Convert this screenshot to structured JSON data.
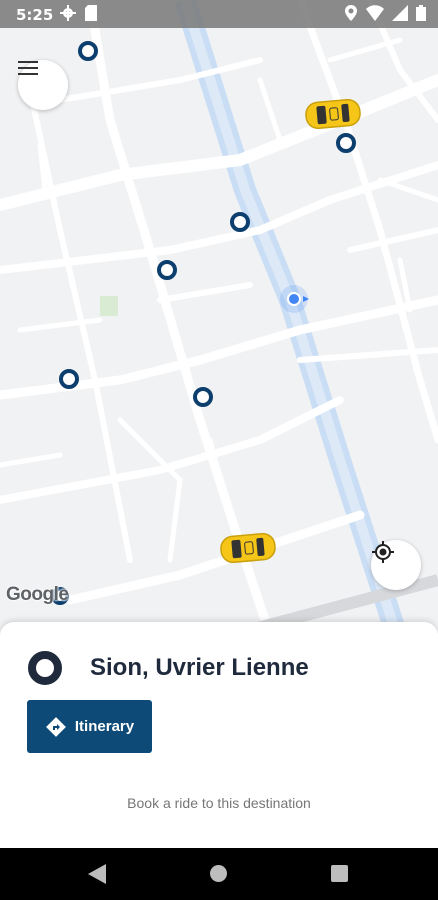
{
  "status_bar": {
    "time": "5:25",
    "left_icons": [
      "gear-icon",
      "sd-card-icon"
    ],
    "right_icons": [
      "location-icon",
      "wifi-icon",
      "signal-icon",
      "battery-icon"
    ]
  },
  "map": {
    "provider_logo": "Google",
    "menu_icon": "hamburger-menu-icon",
    "locate_icon": "my-location-icon",
    "colors": {
      "background": "#f1f2f4",
      "road": "#ffffff",
      "highlight_road": "#c7dcf5",
      "stop_marker": "#0d3f6e",
      "taxi": "#f5c518",
      "user_location": "#4285f4"
    }
  },
  "destination": {
    "name": "Sion, Uvrier Lienne",
    "itinerary_label": "Itinerary",
    "itinerary_icon": "directions-icon",
    "book_text": "Book a ride to this destination"
  },
  "nav_bar": {
    "icons": [
      "back-icon",
      "home-icon",
      "recents-icon"
    ]
  }
}
